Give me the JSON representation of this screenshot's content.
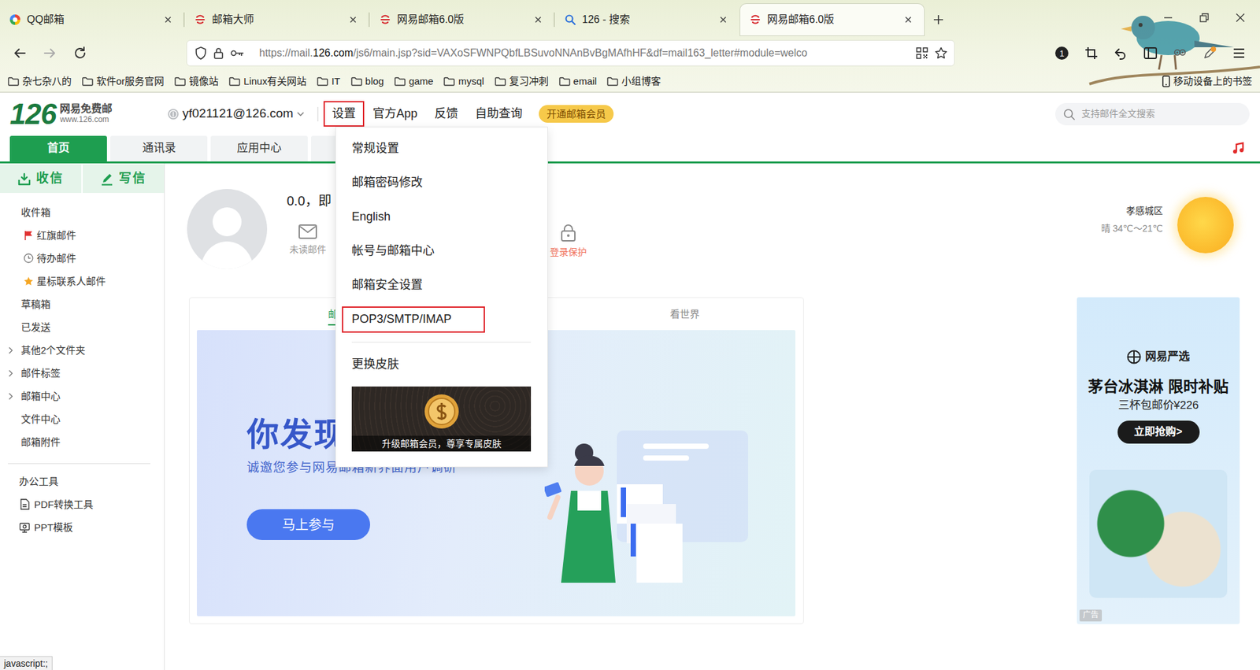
{
  "browser": {
    "tabs": [
      {
        "label": "QQ邮箱",
        "kind": "qq",
        "selected": false
      },
      {
        "label": "邮箱大师",
        "kind": "netease",
        "selected": false
      },
      {
        "label": "网易邮箱6.0版",
        "kind": "netease",
        "selected": false
      },
      {
        "label": "126 - 搜索",
        "kind": "search",
        "selected": false
      },
      {
        "label": "网易邮箱6.0版",
        "kind": "netease",
        "selected": true
      }
    ],
    "address": {
      "prefix": "https://mail.",
      "host": "126.com",
      "rest": "/js6/main.jsp?sid=VAXoSFWNPQbfLBSuvoNNAnBvBgMAfhHF&df=mail163_letter#module=welco"
    },
    "toolbar_badge": "1",
    "bookmarks": [
      "杂七杂八的",
      "软件or服务官网",
      "镜像站",
      "Linux有关网站",
      "IT",
      "blog",
      "game",
      "mysql",
      "复习冲刺",
      "email",
      "小组博客"
    ],
    "mobile_bookmarks": "移动设备上的书签",
    "status": "javascript:;"
  },
  "mail": {
    "logo": {
      "number": "126",
      "name": "网易免费邮",
      "domain": "www.126.com"
    },
    "account": "yf021121@126.com",
    "nav": [
      {
        "label": "设置",
        "highlighted": true
      },
      {
        "label": "官方App",
        "highlighted": false
      },
      {
        "label": "反馈",
        "highlighted": false
      },
      {
        "label": "自助查询",
        "highlighted": false
      }
    ],
    "vip": "开通邮箱会员",
    "search": {
      "placeholder": "支持邮件全文搜索"
    },
    "tabs": [
      {
        "label": "首页",
        "selected": true
      },
      {
        "label": "通讯录",
        "selected": false
      },
      {
        "label": "应用中心",
        "selected": false
      }
    ],
    "receive": "收信",
    "compose": "写信",
    "folders": [
      {
        "label": "收件箱",
        "kind": "plain"
      },
      {
        "label": "红旗邮件",
        "kind": "flag"
      },
      {
        "label": "待办邮件",
        "kind": "clock"
      },
      {
        "label": "星标联系人邮件",
        "kind": "star"
      },
      {
        "label": "草稿箱",
        "kind": "plain"
      },
      {
        "label": "已发送",
        "kind": "plain"
      },
      {
        "label": "其他2个文件夹",
        "kind": "group"
      },
      {
        "label": "邮件标签",
        "kind": "group"
      },
      {
        "label": "邮箱中心",
        "kind": "group"
      },
      {
        "label": "文件中心",
        "kind": "plain"
      },
      {
        "label": "邮箱附件",
        "kind": "plain"
      }
    ],
    "tools_title": "办公工具",
    "tools": [
      {
        "label": "PDF转换工具",
        "kind": "pdf"
      },
      {
        "label": "PPT模板",
        "kind": "ppt"
      }
    ],
    "greeting": "0.0，即",
    "stats": [
      {
        "label": "未读邮件",
        "kind": "mail",
        "warning": false
      },
      {
        "label": "登录保护",
        "kind": "lock",
        "warning": true
      }
    ],
    "weather": {
      "city": "孝感城区",
      "forecast": "晴 34℃～21℃"
    },
    "panel_tabs": [
      {
        "label": "邮",
        "selected": true
      },
      {
        "label": "看世界",
        "selected": false
      }
    ],
    "banner": {
      "title": "你发现",
      "subtitle": "诚邀您参与网易邮箱新界面用户调研",
      "button": "马上参与"
    },
    "ad": {
      "brand": "网易严选",
      "title": "茅台冰淇淋 限时补贴",
      "subtitle": "三杯包邮价¥226",
      "button": "立即抢购>",
      "tag": "广告"
    }
  },
  "menu": {
    "items": [
      {
        "label": "常规设置",
        "highlighted": false
      },
      {
        "label": "邮箱密码修改",
        "highlighted": false
      },
      {
        "label": "English",
        "highlighted": false
      },
      {
        "label": "帐号与邮箱中心",
        "highlighted": false
      },
      {
        "label": "邮箱安全设置",
        "highlighted": false
      },
      {
        "label": "POP3/SMTP/IMAP",
        "highlighted": true
      }
    ],
    "skin": "更换皮肤",
    "promo": "升级邮箱会员，尊享专属皮肤"
  }
}
